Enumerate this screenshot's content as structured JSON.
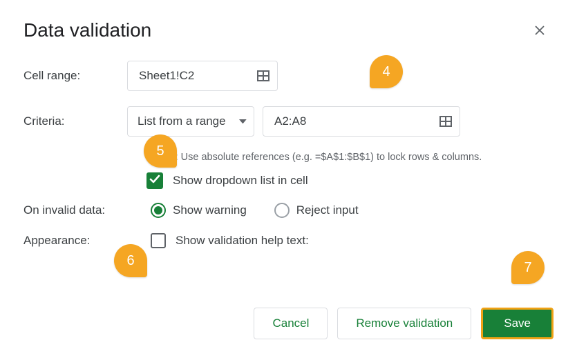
{
  "title": "Data validation",
  "labels": {
    "cell_range": "Cell range:",
    "criteria": "Criteria:",
    "on_invalid": "On invalid data:",
    "appearance": "Appearance:"
  },
  "cell_range": {
    "value": "Sheet1!C2"
  },
  "criteria": {
    "type_label": "List from a range",
    "range_value": "A2:A8"
  },
  "tip": "Tip: Use absolute references (e.g. =$A$1:$B$1) to lock rows & columns.",
  "show_dropdown": {
    "checked": true,
    "label": "Show dropdown list in cell"
  },
  "invalid_options": {
    "show_warning": "Show warning",
    "reject_input": "Reject input",
    "selected": "show_warning"
  },
  "appearance": {
    "show_help_label": "Show validation help text:",
    "checked": false
  },
  "buttons": {
    "cancel": "Cancel",
    "remove": "Remove validation",
    "save": "Save"
  },
  "callouts": {
    "c4": "4",
    "c5": "5",
    "c6": "6",
    "c7": "7"
  }
}
